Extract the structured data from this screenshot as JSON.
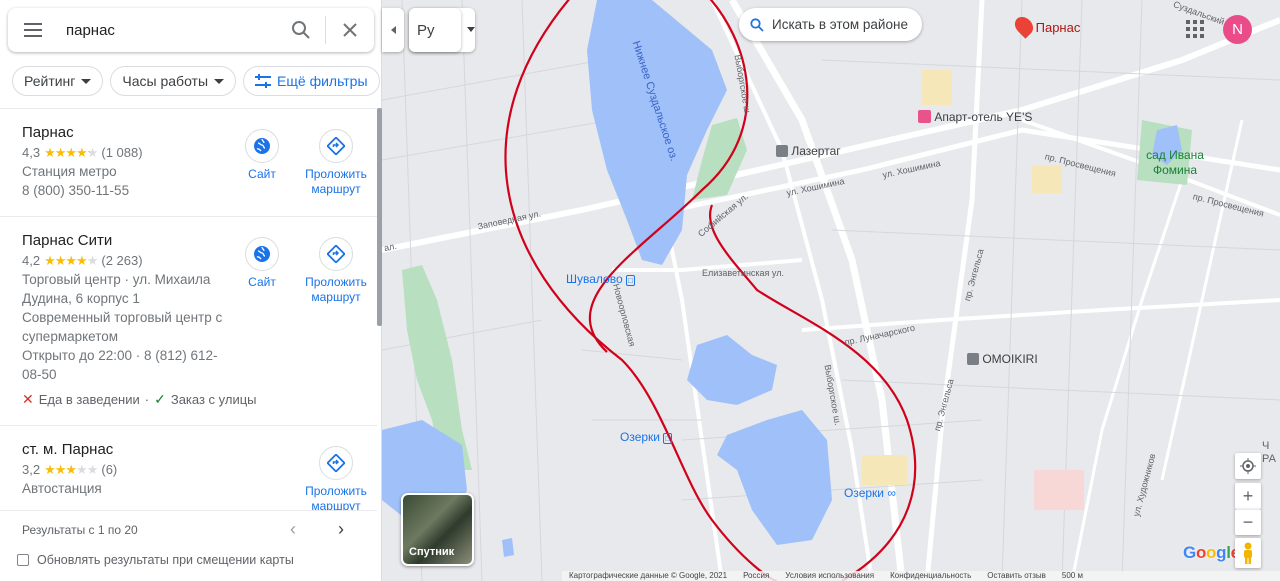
{
  "search": {
    "query": "парнас"
  },
  "filters": {
    "rating": "Рейтинг",
    "hours": "Часы работы",
    "more": "Ещё фильтры"
  },
  "results": [
    {
      "name": "Парнас",
      "rating": "4,3",
      "stars": 4.3,
      "reviews": "(1 088)",
      "lines": [
        "Станция метро",
        "8 (800) 350-11-55"
      ],
      "action_site": "Сайт",
      "action_route": "Проложить маршрут"
    },
    {
      "name": "Парнас Сити",
      "rating": "4,2",
      "stars": 4.2,
      "reviews": "(2 263)",
      "lines": [
        "Торговый центр · ул. Михаила",
        "Дудина, 6 корпус 1",
        "Современный торговый центр с",
        "супермаркетом",
        "Открыто до 22:00 · 8 (812) 612-",
        "08-50"
      ],
      "tags": {
        "dine_in": "Еда в заведении",
        "takeout": "Заказ с улицы"
      },
      "action_site": "Сайт",
      "action_route": "Проложить маршрут"
    },
    {
      "name": "ст. м. Парнас",
      "rating": "3,2",
      "stars": 3.2,
      "reviews": "(6)",
      "lines": [
        "Автостанция"
      ],
      "action_route": "Проложить маршрут"
    }
  ],
  "pager": {
    "text": "Результаты с 1 по 20"
  },
  "update_checkbox": "Обновлять результаты при смещении карты",
  "map": {
    "lang_button": "Ру",
    "search_area": "Искать в этом районе",
    "avatar_letter": "N",
    "satellite": "Спутник",
    "labels": {
      "lake": "Нижнее Суздальское оз.",
      "zapovednaya": "Заповедная ул.",
      "shuvalovo": "Шувалово",
      "novoorlovskaya": "Новоорловская",
      "ozerki_left": "Озерки",
      "ozerki_right": "Озерки",
      "lazertag": "Лазертаг",
      "aparthotel": "Апарт-отель YE'S",
      "parnas_place": "Парнас",
      "sad": "сад Ивана Фомина",
      "prosv1": "пр. Просвещения",
      "prosv2": "пр. Просвещения",
      "hoshimina1": "ул. Хошимина",
      "hoshimina2": "ул. Хошимина",
      "elizavet": "Елизаветинская ул.",
      "lunach": "пр. Луначарского",
      "omoikiri": "OMOIKIRI",
      "vyborg1": "Выборгское ш.",
      "vyborg2": "Выборгское ш.",
      "engels": "пр. Энгельса",
      "engels2": "пр. Энгельса",
      "hudozh": "ул. Художников",
      "suzdal": "Суздальский",
      "sofiyskaya": "Софийская ул.",
      "al": "ал.",
      "edge_text": "Ч\nРА"
    },
    "footer": [
      "Картографические данные © Google, 2021",
      "Россия",
      "Условия использования",
      "Конфиденциальность",
      "Оставить отзыв",
      "500 м"
    ],
    "colors": {
      "water": "#9fc0f8",
      "park": "#b8dfbf",
      "road": "#ffffff",
      "transit": "#1a73e8",
      "drawing": "#d0021b"
    }
  }
}
